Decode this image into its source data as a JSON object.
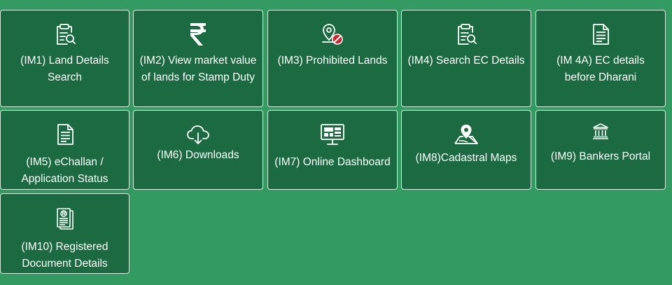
{
  "tiles": [
    {
      "label": "(IM1) Land Details Search",
      "icon": "clipboard-search-icon"
    },
    {
      "label": "(IM2) View market value of lands for Stamp Duty",
      "icon": "rupee-icon"
    },
    {
      "label": "(IM3) Prohibited Lands",
      "icon": "prohibited-location-icon"
    },
    {
      "label": "(IM4) Search EC Details",
      "icon": "clipboard-search-icon"
    },
    {
      "label": "(IM 4A) EC details before Dharani",
      "icon": "document-icon"
    },
    {
      "label": "(IM5) eChallan / Application Status",
      "icon": "document-icon"
    },
    {
      "label": "(IM6) Downloads",
      "icon": "cloud-download-icon"
    },
    {
      "label": "(IM7) Online Dashboard",
      "icon": "dashboard-monitor-icon"
    },
    {
      "label": "(IM8)Cadastral Maps",
      "icon": "map-location-icon"
    },
    {
      "label": "(IM9) Bankers Portal",
      "icon": "bank-icon"
    },
    {
      "label": "(IM10) Registered Document Details",
      "icon": "registered-document-icon"
    }
  ],
  "colors": {
    "page_background": "#339b61",
    "tile_background": "#1c6a42",
    "tile_border": "#d8ecdf",
    "prohibited_red": "#d4202c"
  }
}
